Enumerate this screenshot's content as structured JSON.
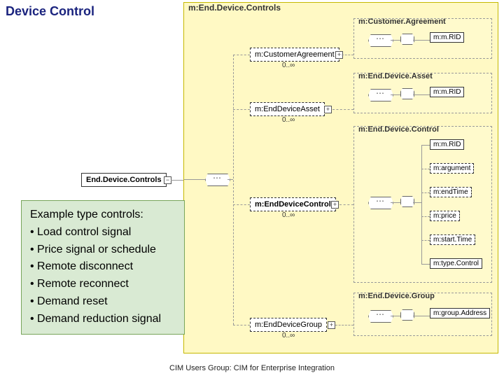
{
  "title": "Device Control",
  "root_box": "End.Device.Controls",
  "panel_label": "m:End.Device.Controls",
  "groups": {
    "customer_agreement": {
      "label": "m:Customer.Agreement",
      "entity": "m:CustomerAgreement",
      "attr": "m:m.RID",
      "card": "0..∞"
    },
    "end_device_asset": {
      "label": "m:End.Device.Asset",
      "entity": "m:EndDeviceAsset",
      "attr": "m:m.RID",
      "card": "0..∞"
    },
    "end_device_control": {
      "label": "m:End.Device.Control",
      "entity": "m:EndDeviceControl",
      "attrs": [
        "m:m.RID",
        "m:argument",
        "m:endTime",
        "m:price",
        "m:start.Time",
        "m:type.Control"
      ],
      "card": "0..∞"
    },
    "end_device_group": {
      "label": "m:End.Device.Group",
      "entity": "m:EndDeviceGroup",
      "attr": "m:group.Address",
      "card": "0..∞"
    }
  },
  "example": {
    "heading": "Example type controls:",
    "items": [
      "Load control signal",
      "Price signal or schedule",
      "Remote disconnect",
      "Remote reconnect",
      "Demand reset",
      "Demand reduction signal"
    ]
  },
  "footer": "CIM Users Group: CIM for Enterprise Integration"
}
